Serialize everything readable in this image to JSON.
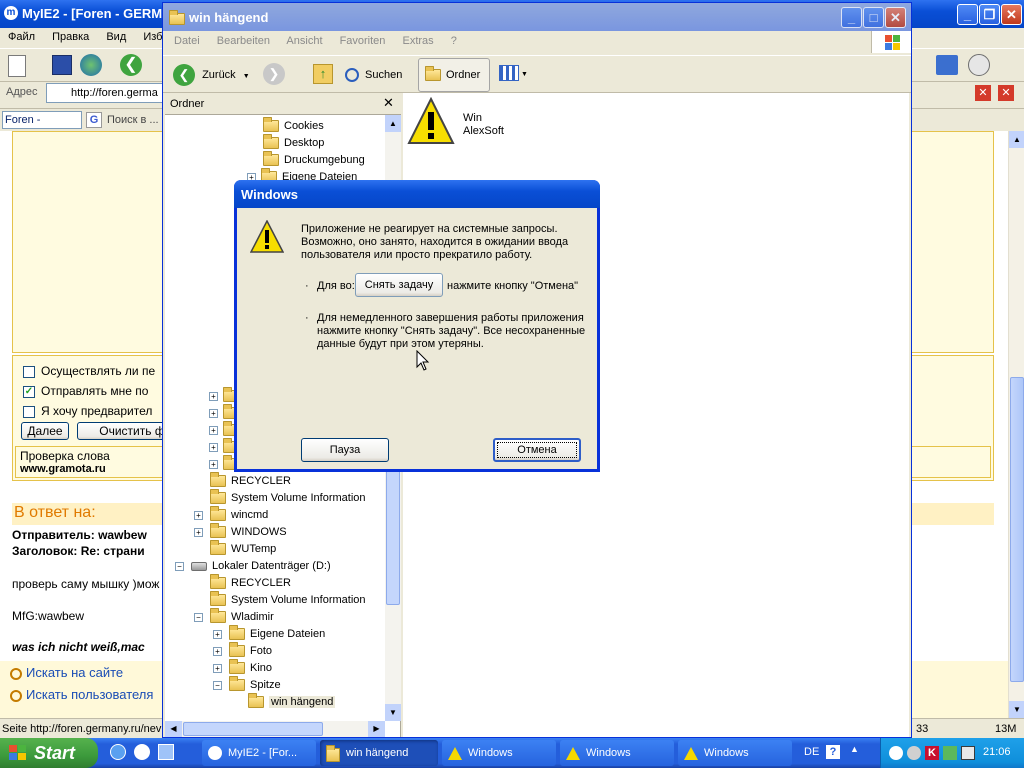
{
  "browser": {
    "title": "MyIE2 - [Foren - GERM",
    "menu": [
      "Файл",
      "Правка",
      "Вид",
      "Избр"
    ],
    "address_label": "Адрес",
    "address_value": "http://foren.germa",
    "tab_label": "Foren - GERM...",
    "search_placeholder": "Поиск в ...",
    "status_text": "Seite http://foren.germany.ru/nev",
    "status_right1": "33",
    "status_right2": "13M",
    "content": {
      "checkbox1": "Осуществлять ли пе",
      "checkbox2": "Отправлять мне по",
      "checkbox3": "Я хочу предварител",
      "btn_next": "Далее",
      "btn_clear": "Очистить ф",
      "spell_label": "Проверка слова",
      "spell_link": "www.gramota.ru",
      "reply_heading": "В ответ на:",
      "sender": "Отправитель: wawbew",
      "subject": "Заголовок: Re: страни",
      "text1": "проверь саму мышку )мож",
      "text2": "MfG:wawbew",
      "text3": "was ich nicht weiß,mac",
      "link1": "Искать на сайте",
      "link2": "Искать пользователя"
    }
  },
  "explorer": {
    "title": "win hängend",
    "menu": [
      "Datei",
      "Bearbeiten",
      "Ansicht",
      "Favoriten",
      "Extras",
      "?"
    ],
    "toolbar": {
      "back": "Zurück",
      "search": "Suchen",
      "folders": "Ordner"
    },
    "panel_title": "Ordner",
    "tree_top": [
      "Cookies",
      "Desktop",
      "Druckumgebung",
      "Eigene Dateien"
    ],
    "tree_bottom": [
      {
        "label": "RECYCLER",
        "indent": 1,
        "pm": ""
      },
      {
        "label": "System Volume Information",
        "indent": 1,
        "pm": ""
      },
      {
        "label": "wincmd",
        "indent": 1,
        "pm": "+"
      },
      {
        "label": "WINDOWS",
        "indent": 1,
        "pm": "+"
      },
      {
        "label": "WUTemp",
        "indent": 1,
        "pm": ""
      },
      {
        "label": "Lokaler Datenträger (D:)",
        "indent": 0,
        "pm": "−",
        "drive": true
      },
      {
        "label": "RECYCLER",
        "indent": 1,
        "pm": ""
      },
      {
        "label": "System Volume Information",
        "indent": 1,
        "pm": ""
      },
      {
        "label": "Wladimir",
        "indent": 1,
        "pm": "−"
      },
      {
        "label": "Eigene Dateien",
        "indent": 2,
        "pm": "+"
      },
      {
        "label": "Foto",
        "indent": 2,
        "pm": "+"
      },
      {
        "label": "Kino",
        "indent": 2,
        "pm": "+"
      },
      {
        "label": "Spitze",
        "indent": 2,
        "pm": "−"
      },
      {
        "label": "win hängend",
        "indent": 3,
        "pm": "",
        "selected": true
      }
    ],
    "file_name_line1": "Win",
    "file_name_line2": "AlexSoft"
  },
  "dialog": {
    "title": "Windows",
    "message": "Приложение не реагирует на системные запросы. Возможно, оно занято, находится в ожидании ввода пользователя или просто прекратило работу.",
    "bullet1_prefix": "Для во:",
    "bullet1_suffix": "нажмите кнопку \"Отмена\"",
    "end_task_button": "Снять задачу",
    "bullet2": "Для немедленного завершения работы приложения нажмите кнопку \"Снять задачу\". Все несохраненные данные будут при этом утеряны.",
    "pause_button": "Пауза",
    "cancel_button": "Отмена"
  },
  "taskbar": {
    "start": "Start",
    "tasks": [
      "MyIE2 - [For...",
      "win hängend",
      "Windows",
      "Windows",
      "Windows"
    ],
    "lang": "DE",
    "clock": "21:06"
  },
  "colors": {
    "xp_blue": "#0A4FD6",
    "taskbar": "#245EDB",
    "start_green": "#3C9A3C",
    "dialog_bg": "#ECE9D8",
    "heading_orange": "#E07A00"
  }
}
